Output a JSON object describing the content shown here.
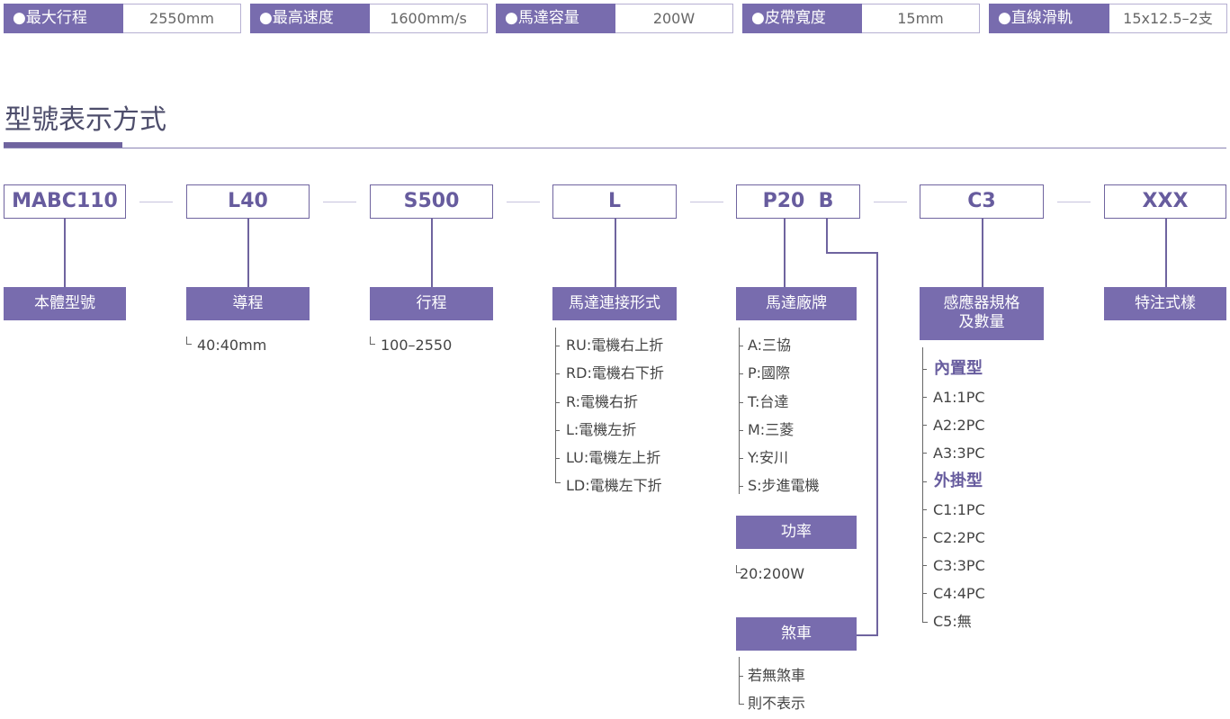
{
  "specs": [
    {
      "label": "●最大行程",
      "value": "2550mm"
    },
    {
      "label": "●最高速度",
      "value": "1600mm/s"
    },
    {
      "label": "●馬達容量",
      "value": "200W"
    },
    {
      "label": "●皮帶寬度",
      "value": "15mm"
    },
    {
      "label": "●直線滑軌",
      "value": "15x12.5–2支"
    }
  ],
  "section_title": "型號表示方式",
  "codes": [
    "MABC110",
    "L40",
    "S500",
    "L",
    "P20  B",
    "C3",
    "XXX"
  ],
  "labels": {
    "model": "本體型號",
    "lead": "導程",
    "stroke": "行程",
    "motor_mount": "馬達連接形式",
    "motor_brand": "馬達廠牌",
    "sensor": "感應器規格\n及數量",
    "special": "特注式樣",
    "power": "功率",
    "brake": "煞車"
  },
  "lead_options": [
    "40:40mm"
  ],
  "stroke_options": [
    "100–2550"
  ],
  "mount_options": [
    "RU:電機右上折",
    "RD:電機右下折",
    "R:電機右折",
    "L:電機左折",
    "LU:電機左上折",
    "LD:電機左下折"
  ],
  "brand_options": [
    "A:三協",
    "P:國際",
    "T:台達",
    "M:三菱",
    "Y:安川",
    "S:步進電機"
  ],
  "power_options": [
    "20:200W"
  ],
  "brake_options": [
    "若無煞車",
    "則不表示"
  ],
  "sensor_groups": [
    {
      "title": "內置型",
      "items": [
        "A1:1PC",
        "A2:2PC",
        "A3:3PC"
      ]
    },
    {
      "title": "外掛型",
      "items": [
        "C1:1PC",
        "C2:2PC",
        "C3:3PC",
        "C4:4PC",
        "C5:無"
      ]
    }
  ],
  "colors": {
    "accent": "#786cae",
    "accent_dark": "#675c9e",
    "border": "#b6b0d2"
  }
}
